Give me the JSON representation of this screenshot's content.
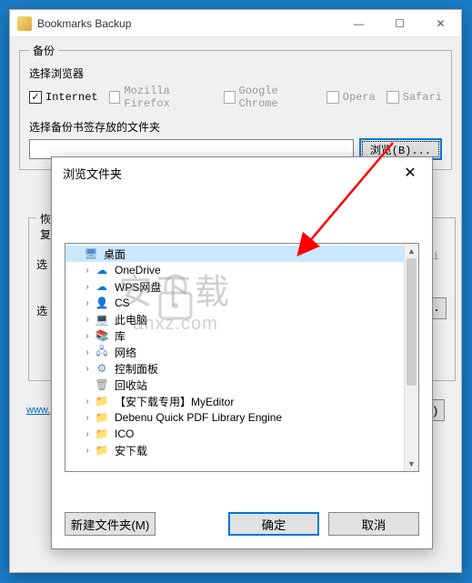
{
  "main": {
    "title": "Bookmarks Backup",
    "backup_legend": "备份",
    "browser_label": "选择浏览器",
    "browsers": [
      {
        "label": "Internet",
        "checked": true,
        "enabled": true
      },
      {
        "label": "Mozilla Firefox",
        "checked": false,
        "enabled": false
      },
      {
        "label": "Google Chrome",
        "checked": false,
        "enabled": false
      },
      {
        "label": "Opera",
        "checked": false,
        "enabled": false
      },
      {
        "label": "Safari",
        "checked": false,
        "enabled": false
      }
    ],
    "folder_label": "选择备份书签存放的文件夹",
    "path_value": "",
    "browse_btn": "浏览(B)...",
    "restore_legend": "恢复",
    "restore_sel1": "选",
    "restore_sel2": "选",
    "right_badge": "afari",
    "partial_btn": ")...",
    "exit_btn": "出(X)",
    "url": "www."
  },
  "dialog": {
    "title": "浏览文件夹",
    "tree": [
      {
        "label": "桌面",
        "icon": "desktop",
        "selected": true,
        "expandable": false,
        "indent": 0
      },
      {
        "label": "OneDrive",
        "icon": "cloud-blue",
        "expandable": true,
        "indent": 1
      },
      {
        "label": "WPS网盘",
        "icon": "cloud-outline",
        "expandable": true,
        "indent": 1
      },
      {
        "label": "CS",
        "icon": "person",
        "expandable": true,
        "indent": 1
      },
      {
        "label": "此电脑",
        "icon": "pc",
        "expandable": true,
        "indent": 1
      },
      {
        "label": "库",
        "icon": "lib",
        "expandable": true,
        "indent": 1
      },
      {
        "label": "网络",
        "icon": "net",
        "expandable": true,
        "indent": 1
      },
      {
        "label": "控制面板",
        "icon": "panel",
        "expandable": true,
        "indent": 1
      },
      {
        "label": "回收站",
        "icon": "recycle",
        "expandable": false,
        "indent": 1
      },
      {
        "label": "【安下载专用】MyEditor",
        "icon": "folder",
        "expandable": true,
        "indent": 1
      },
      {
        "label": "Debenu Quick PDF Library Engine",
        "icon": "folder",
        "expandable": true,
        "indent": 1
      },
      {
        "label": "ICO",
        "icon": "folder",
        "expandable": true,
        "indent": 1
      },
      {
        "label": "安下载",
        "icon": "folder",
        "expandable": true,
        "indent": 1
      }
    ],
    "new_folder_btn": "新建文件夹(M)",
    "ok_btn": "确定",
    "cancel_btn": "取消"
  },
  "watermark": {
    "cn": "安下载",
    "en": "anxz.com"
  }
}
